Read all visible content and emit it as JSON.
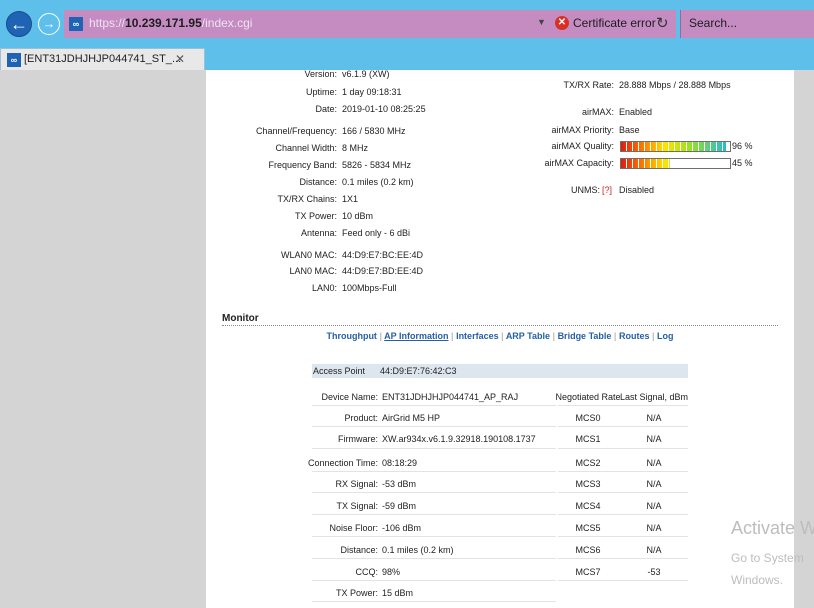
{
  "browser": {
    "url_prefix": "https://",
    "url_host": "10.239.171.95",
    "url_path": "/index.cgi",
    "cert_error": "Certificate error",
    "search_placeholder": "Search...",
    "tab_title": "[ENT31JDHJHJP044741_ST_..."
  },
  "status_left": [
    {
      "label": "Version:",
      "value": "v6.1.9 (XW)"
    },
    {
      "label": "Uptime:",
      "value": "1 day 09:18:31"
    },
    {
      "label": "Date:",
      "value": "2019-01-10 08:25:25"
    },
    {
      "label": "Channel/Frequency:",
      "value": "166 / 5830 MHz"
    },
    {
      "label": "Channel Width:",
      "value": "8 MHz"
    },
    {
      "label": "Frequency Band:",
      "value": "5826 - 5834 MHz"
    },
    {
      "label": "Distance:",
      "value": "0.1 miles (0.2 km)"
    },
    {
      "label": "TX/RX Chains:",
      "value": "1X1"
    },
    {
      "label": "TX Power:",
      "value": "10 dBm"
    },
    {
      "label": "Antenna:",
      "value": "Feed only - 6 dBi"
    },
    {
      "label": "WLAN0 MAC:",
      "value": "44:D9:E7:BC:EE:4D"
    },
    {
      "label": "LAN0 MAC:",
      "value": "44:D9:E7:BD:EE:4D"
    },
    {
      "label": "LAN0:",
      "value": "100Mbps-Full"
    }
  ],
  "status_right": {
    "txrx_rate": {
      "label": "TX/RX Rate:",
      "value": "28.888 Mbps / 28.888 Mbps"
    },
    "airmax": {
      "label": "airMAX:",
      "value": "Enabled"
    },
    "airmax_priority": {
      "label": "airMAX Priority:",
      "value": "Base"
    },
    "airmax_quality": {
      "label": "airMAX Quality:",
      "percent": 96,
      "text": "96 %"
    },
    "airmax_capacity": {
      "label": "airMAX Capacity:",
      "percent": 45,
      "text": "45 %"
    },
    "unms": {
      "label": "UNMS:",
      "help": "[?]",
      "value": "Disabled"
    }
  },
  "monitor": {
    "title": "Monitor",
    "links": [
      "Throughput",
      "AP Information",
      "Interfaces",
      "ARP Table",
      "Bridge Table",
      "Routes",
      "Log"
    ],
    "selected": "AP Information",
    "separator": "|"
  },
  "ap_info": {
    "header_label": "Access Point",
    "header_mac": "44:D9:E7:76:42:C3",
    "col_rate": "Negotiated Rate",
    "col_signal": "Last Signal, dBm",
    "details": [
      {
        "label": "Device Name:",
        "value": "ENT31JDHJHJP044741_AP_RAJ"
      },
      {
        "label": "Product:",
        "value": "AirGrid M5 HP"
      },
      {
        "label": "Firmware:",
        "value": "XW.ar934x.v6.1.9.32918.190108.1737"
      },
      {
        "label": "Connection Time:",
        "value": "08:18:29"
      },
      {
        "label": "RX Signal:",
        "value": "-53 dBm"
      },
      {
        "label": "TX Signal:",
        "value": "-59 dBm"
      },
      {
        "label": "Noise Floor:",
        "value": "-106 dBm"
      },
      {
        "label": "Distance:",
        "value": "0.1 miles (0.2 km)"
      },
      {
        "label": "CCQ:",
        "value": "98%"
      },
      {
        "label": "TX Power:",
        "value": "15 dBm"
      }
    ],
    "rates": [
      {
        "rate": "MCS0",
        "signal": "N/A"
      },
      {
        "rate": "MCS1",
        "signal": "N/A"
      },
      {
        "rate": "MCS2",
        "signal": "N/A"
      },
      {
        "rate": "MCS3",
        "signal": "N/A"
      },
      {
        "rate": "MCS4",
        "signal": "N/A"
      },
      {
        "rate": "MCS5",
        "signal": "N/A"
      },
      {
        "rate": "MCS6",
        "signal": "N/A"
      },
      {
        "rate": "MCS7",
        "signal": "-53"
      }
    ]
  },
  "watermark": {
    "line1": "Activate W",
    "line2": "Go to System",
    "line3": "Windows."
  }
}
